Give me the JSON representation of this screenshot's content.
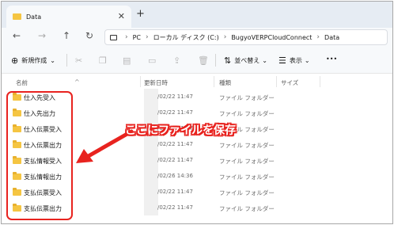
{
  "tab": {
    "title": "Data",
    "close": "✕",
    "new_tab": "+"
  },
  "nav": {
    "back": "←",
    "forward": "→",
    "up": "↑",
    "refresh": "↻"
  },
  "breadcrumb": [
    "PC",
    "ローカル ディスク (C:)",
    "BugyoVERPCloudConnect",
    "Data"
  ],
  "breadcrumb_separator": "›",
  "toolbar": {
    "new_label": "新規作成",
    "new_caret": "⌄",
    "sort_label": "並べ替え",
    "view_label": "表示",
    "more_label": "•••"
  },
  "columns": {
    "name": "名前",
    "modified": "更新日時",
    "type": "種類",
    "size": "サイズ",
    "sort_caret": "^"
  },
  "files": [
    {
      "name": "仕入先受入",
      "date": "/02/22 11:47",
      "type": "ファイル フォルダー"
    },
    {
      "name": "仕入先出力",
      "date": "/02/22 11:47",
      "type": "ファイル フォルダー"
    },
    {
      "name": "仕入伝票受入",
      "date": "/02/22 11:47",
      "type": "ファイル フォルダー"
    },
    {
      "name": "仕入伝票出力",
      "date": "/02/22 11:47",
      "type": "ファイル フォルダー"
    },
    {
      "name": "支払情報受入",
      "date": "/02/22 11:47",
      "type": "ファイル フォルダー"
    },
    {
      "name": "支払情報出力",
      "date": "/02/26 14:36",
      "type": "ファイル フォルダー"
    },
    {
      "name": "支払伝票受入",
      "date": "/02/22 11:47",
      "type": "ファイル フォルダー"
    },
    {
      "name": "支払伝票出力",
      "date": "/02/22 11:47",
      "type": "ファイル フォルダー"
    }
  ],
  "annotation": {
    "text": "ここにファイルを保存",
    "color": "#e8231f"
  }
}
